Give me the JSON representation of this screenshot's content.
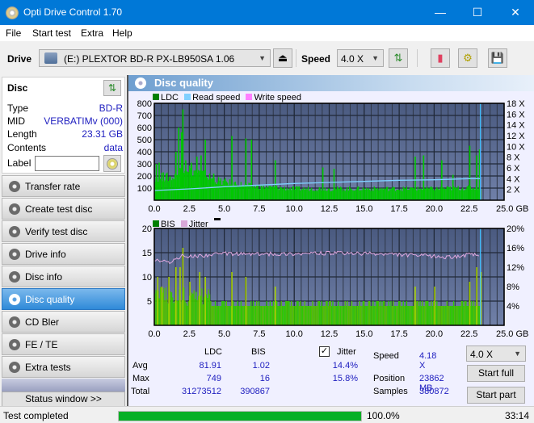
{
  "window": {
    "title": "Opti Drive Control 1.70",
    "minimize": "—",
    "maximize": "☐",
    "close": "✕"
  },
  "menu": [
    "File",
    "Start test",
    "Extra",
    "Help"
  ],
  "toolbar": {
    "drive_label": "Drive",
    "drive_value": "(E:)  PLEXTOR BD-R  PX-LB950SA 1.06",
    "speed_label": "Speed",
    "speed_value": "4.0 X"
  },
  "disc": {
    "header": "Disc",
    "rows": [
      {
        "label": "Type",
        "value": "BD-R"
      },
      {
        "label": "MID",
        "value": "VERBATIMv (000)"
      },
      {
        "label": "Length",
        "value": "23.31 GB"
      },
      {
        "label": "Contents",
        "value": "data"
      }
    ],
    "label_field": "Label",
    "label_value": ""
  },
  "nav": [
    {
      "label": "Transfer rate",
      "active": false
    },
    {
      "label": "Create test disc",
      "active": false
    },
    {
      "label": "Verify test disc",
      "active": false
    },
    {
      "label": "Drive info",
      "active": false
    },
    {
      "label": "Disc info",
      "active": false
    },
    {
      "label": "Disc quality",
      "active": true
    },
    {
      "label": "CD Bler",
      "active": false
    },
    {
      "label": "FE / TE",
      "active": false
    },
    {
      "label": "Extra tests",
      "active": false
    }
  ],
  "status_window_button": "Status window >>",
  "panel": {
    "title": "Disc quality"
  },
  "chart_data": [
    {
      "type": "bar",
      "title": "LDC / Read speed",
      "legend": [
        "LDC",
        "Read speed",
        "Write speed"
      ],
      "colors": {
        "LDC": "#00c800",
        "Read speed": "#80d0ff",
        "Write speed": "#ff80ff"
      },
      "xlabel": "GB",
      "xlim": [
        0,
        25
      ],
      "xticks": [
        "0.0",
        "2.5",
        "5.0",
        "7.5",
        "10.0",
        "12.5",
        "15.0",
        "17.5",
        "20.0",
        "22.5",
        "25.0 GB"
      ],
      "ylim": [
        0,
        800
      ],
      "yticks": [
        "100",
        "200",
        "300",
        "400",
        "500",
        "600",
        "700",
        "800"
      ],
      "y2lim": [
        0,
        18
      ],
      "y2ticks": [
        "2 X",
        "4 X",
        "6 X",
        "8 X",
        "10 X",
        "12 X",
        "14 X",
        "16 X",
        "18 X"
      ],
      "ldc_spikes": [
        [
          0.1,
          300
        ],
        [
          0.3,
          310
        ],
        [
          0.6,
          230
        ],
        [
          1.5,
          400
        ],
        [
          1.7,
          600
        ],
        [
          1.9,
          560
        ],
        [
          2.0,
          750
        ],
        [
          2.2,
          330
        ],
        [
          2.6,
          310
        ],
        [
          3.0,
          360
        ],
        [
          3.3,
          370
        ],
        [
          3.6,
          500
        ],
        [
          4.2,
          220
        ],
        [
          5.5,
          530
        ],
        [
          6.5,
          510
        ],
        [
          6.9,
          500
        ],
        [
          8.6,
          330
        ],
        [
          12.0,
          270
        ],
        [
          12.8,
          260
        ],
        [
          18.6,
          360
        ],
        [
          19.2,
          370
        ],
        [
          20.5,
          330
        ],
        [
          21.3,
          210
        ],
        [
          22.5,
          450
        ],
        [
          23.0,
          370
        ],
        [
          23.2,
          420
        ]
      ],
      "ldc_baseline": [
        [
          0,
          200
        ],
        [
          1.5,
          200
        ],
        [
          2.0,
          300
        ],
        [
          3.5,
          220
        ],
        [
          4.5,
          170
        ],
        [
          7.0,
          120
        ],
        [
          10,
          100
        ],
        [
          15,
          100
        ],
        [
          20,
          100
        ],
        [
          23.3,
          110
        ]
      ],
      "read_speed": [
        [
          0,
          1.8
        ],
        [
          2.5,
          2.1
        ],
        [
          5,
          2.5
        ],
        [
          7.5,
          2.8
        ],
        [
          10,
          3.1
        ],
        [
          12.5,
          3.3
        ],
        [
          15,
          3.5
        ],
        [
          17.5,
          3.7
        ],
        [
          20,
          3.8
        ],
        [
          22.5,
          4.0
        ],
        [
          23.3,
          4.0
        ]
      ],
      "end_marker_gb": 23.3
    },
    {
      "type": "bar",
      "title": "BIS / Jitter",
      "legend": [
        "BIS",
        "Jitter"
      ],
      "colors": {
        "BIS": "#40c800",
        "Jitter": "#e0a0e0"
      },
      "xlabel": "GB",
      "xlim": [
        0,
        25
      ],
      "xticks": [
        "0.0",
        "2.5",
        "5.0",
        "7.5",
        "10.0",
        "12.5",
        "15.0",
        "17.5",
        "20.0",
        "22.5",
        "25.0 GB"
      ],
      "ylim": [
        0,
        20
      ],
      "yticks": [
        "5",
        "10",
        "15",
        "20"
      ],
      "y2lim": [
        0,
        20
      ],
      "y2ticks": [
        "4%",
        "8%",
        "12%",
        "16%",
        "20%"
      ],
      "bis_spikes": [
        [
          0.2,
          10
        ],
        [
          0.5,
          8
        ],
        [
          1.0,
          10
        ],
        [
          1.5,
          12
        ],
        [
          1.8,
          12
        ],
        [
          2.0,
          16
        ],
        [
          2.5,
          9
        ],
        [
          3.2,
          11
        ],
        [
          3.6,
          10
        ],
        [
          5.5,
          11
        ],
        [
          6.5,
          10
        ],
        [
          8.6,
          8
        ],
        [
          18.6,
          8
        ],
        [
          20.0,
          8
        ],
        [
          22.5,
          9
        ],
        [
          23.0,
          12
        ],
        [
          23.3,
          11
        ]
      ],
      "bis_baseline": 4,
      "jitter": [
        [
          0,
          13.5
        ],
        [
          1,
          13
        ],
        [
          2,
          14.3
        ],
        [
          2.5,
          14.2
        ],
        [
          5,
          14.8
        ],
        [
          7.5,
          14.7
        ],
        [
          10,
          14.8
        ],
        [
          12.5,
          14.9
        ],
        [
          15,
          14.8
        ],
        [
          17.5,
          14.6
        ],
        [
          20,
          14.3
        ],
        [
          21,
          14.0
        ],
        [
          22.5,
          14.6
        ],
        [
          23.3,
          14.5
        ]
      ],
      "end_marker_gb": 23.3
    }
  ],
  "stats": {
    "col_ldc": "LDC",
    "col_bis": "BIS",
    "jitter_label": "Jitter",
    "jitter_checked": true,
    "rows": [
      {
        "label": "Avg",
        "ldc": "81.91",
        "bis": "1.02",
        "jitter": "14.4%"
      },
      {
        "label": "Max",
        "ldc": "749",
        "bis": "16",
        "jitter": "15.8%"
      },
      {
        "label": "Total",
        "ldc": "31273512",
        "bis": "390867",
        "jitter": ""
      }
    ],
    "speed_label": "Speed",
    "speed_value": "4.18 X",
    "position_label": "Position",
    "position_value": "23862 MB",
    "samples_label": "Samples",
    "samples_value": "380872",
    "speed_select": "4.0 X",
    "start_full": "Start full",
    "start_part": "Start part"
  },
  "statusbar": {
    "status": "Test completed",
    "progress": 100.0,
    "progress_text": "100.0%",
    "time": "33:14"
  }
}
